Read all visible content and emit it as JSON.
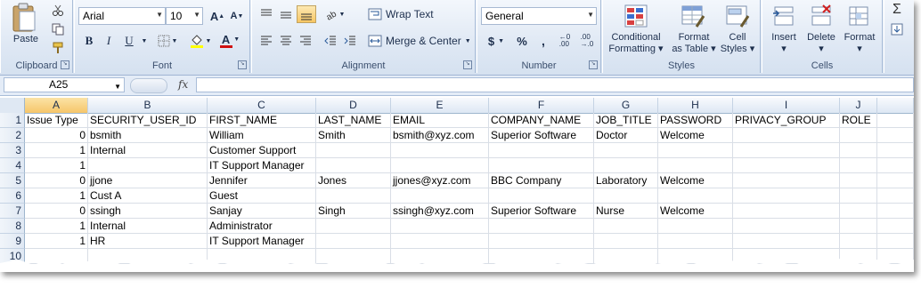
{
  "ribbon": {
    "clipboard": {
      "label": "Clipboard",
      "paste": "Paste"
    },
    "font": {
      "label": "Font",
      "name": "Arial",
      "size": "10",
      "bold": "B",
      "italic": "I",
      "underline": "U",
      "grow": "A",
      "shrink": "A",
      "font_color_glyph": "A"
    },
    "alignment": {
      "label": "Alignment",
      "wrap_text": "Wrap Text",
      "merge_center": "Merge & Center"
    },
    "number": {
      "label": "Number",
      "format": "General",
      "currency": "$",
      "percent": "%",
      "comma": ","
    },
    "styles": {
      "label": "Styles",
      "conditional": "Conditional",
      "formatting": "Formatting",
      "format_as": "Format",
      "as_table": "as Table",
      "cell": "Cell",
      "styles_btn": "Styles"
    },
    "cells": {
      "label": "Cells",
      "insert": "Insert",
      "delete": "Delete",
      "format": "Format"
    }
  },
  "formula_bar": {
    "name_box": "A25",
    "fx": "fx",
    "formula": ""
  },
  "columns": [
    "A",
    "B",
    "C",
    "D",
    "E",
    "F",
    "G",
    "H",
    "I",
    "J"
  ],
  "rows": [
    {
      "num": "1",
      "cells": [
        "Issue Type",
        "SECURITY_USER_ID",
        "FIRST_NAME",
        "LAST_NAME",
        "EMAIL",
        "COMPANY_NAME",
        "JOB_TITLE",
        "PASSWORD",
        "PRIVACY_GROUP",
        "ROLE"
      ]
    },
    {
      "num": "2",
      "cells": [
        "0",
        "bsmith",
        "William",
        "Smith",
        "bsmith@xyz.com",
        "Superior Software",
        "Doctor",
        "Welcome",
        "",
        ""
      ]
    },
    {
      "num": "3",
      "cells": [
        "1",
        "Internal",
        "Customer Support",
        "",
        "",
        "",
        "",
        "",
        "",
        ""
      ]
    },
    {
      "num": "4",
      "cells": [
        "1",
        "",
        "IT Support Manager",
        "",
        "",
        "",
        "",
        "",
        "",
        ""
      ]
    },
    {
      "num": "5",
      "cells": [
        "0",
        "jjone",
        "Jennifer",
        "Jones",
        "jjones@xyz.com",
        "BBC Company",
        "Laboratory",
        "Welcome",
        "",
        ""
      ]
    },
    {
      "num": "6",
      "cells": [
        "1",
        "Cust A",
        "Guest",
        "",
        "",
        "",
        "",
        "",
        "",
        ""
      ]
    },
    {
      "num": "7",
      "cells": [
        "0",
        "ssingh",
        "Sanjay",
        "Singh",
        "ssingh@xyz.com",
        "Superior Software",
        "Nurse",
        "Welcome",
        "",
        ""
      ]
    },
    {
      "num": "8",
      "cells": [
        "1",
        "Internal",
        "Administrator",
        "",
        "",
        "",
        "",
        "",
        "",
        ""
      ]
    },
    {
      "num": "9",
      "cells": [
        "1",
        "HR",
        "IT Support Manager",
        "",
        "",
        "",
        "",
        "",
        "",
        ""
      ]
    },
    {
      "num": "10",
      "cells": [
        "",
        "",
        "",
        "",
        "",
        "",
        "",
        "",
        "",
        ""
      ]
    }
  ],
  "colors": {
    "ribbon_bg": "#dfe8f4",
    "header_selected": "#f6c66a",
    "font_color": "#d01010",
    "highlight": "#ffff00"
  }
}
